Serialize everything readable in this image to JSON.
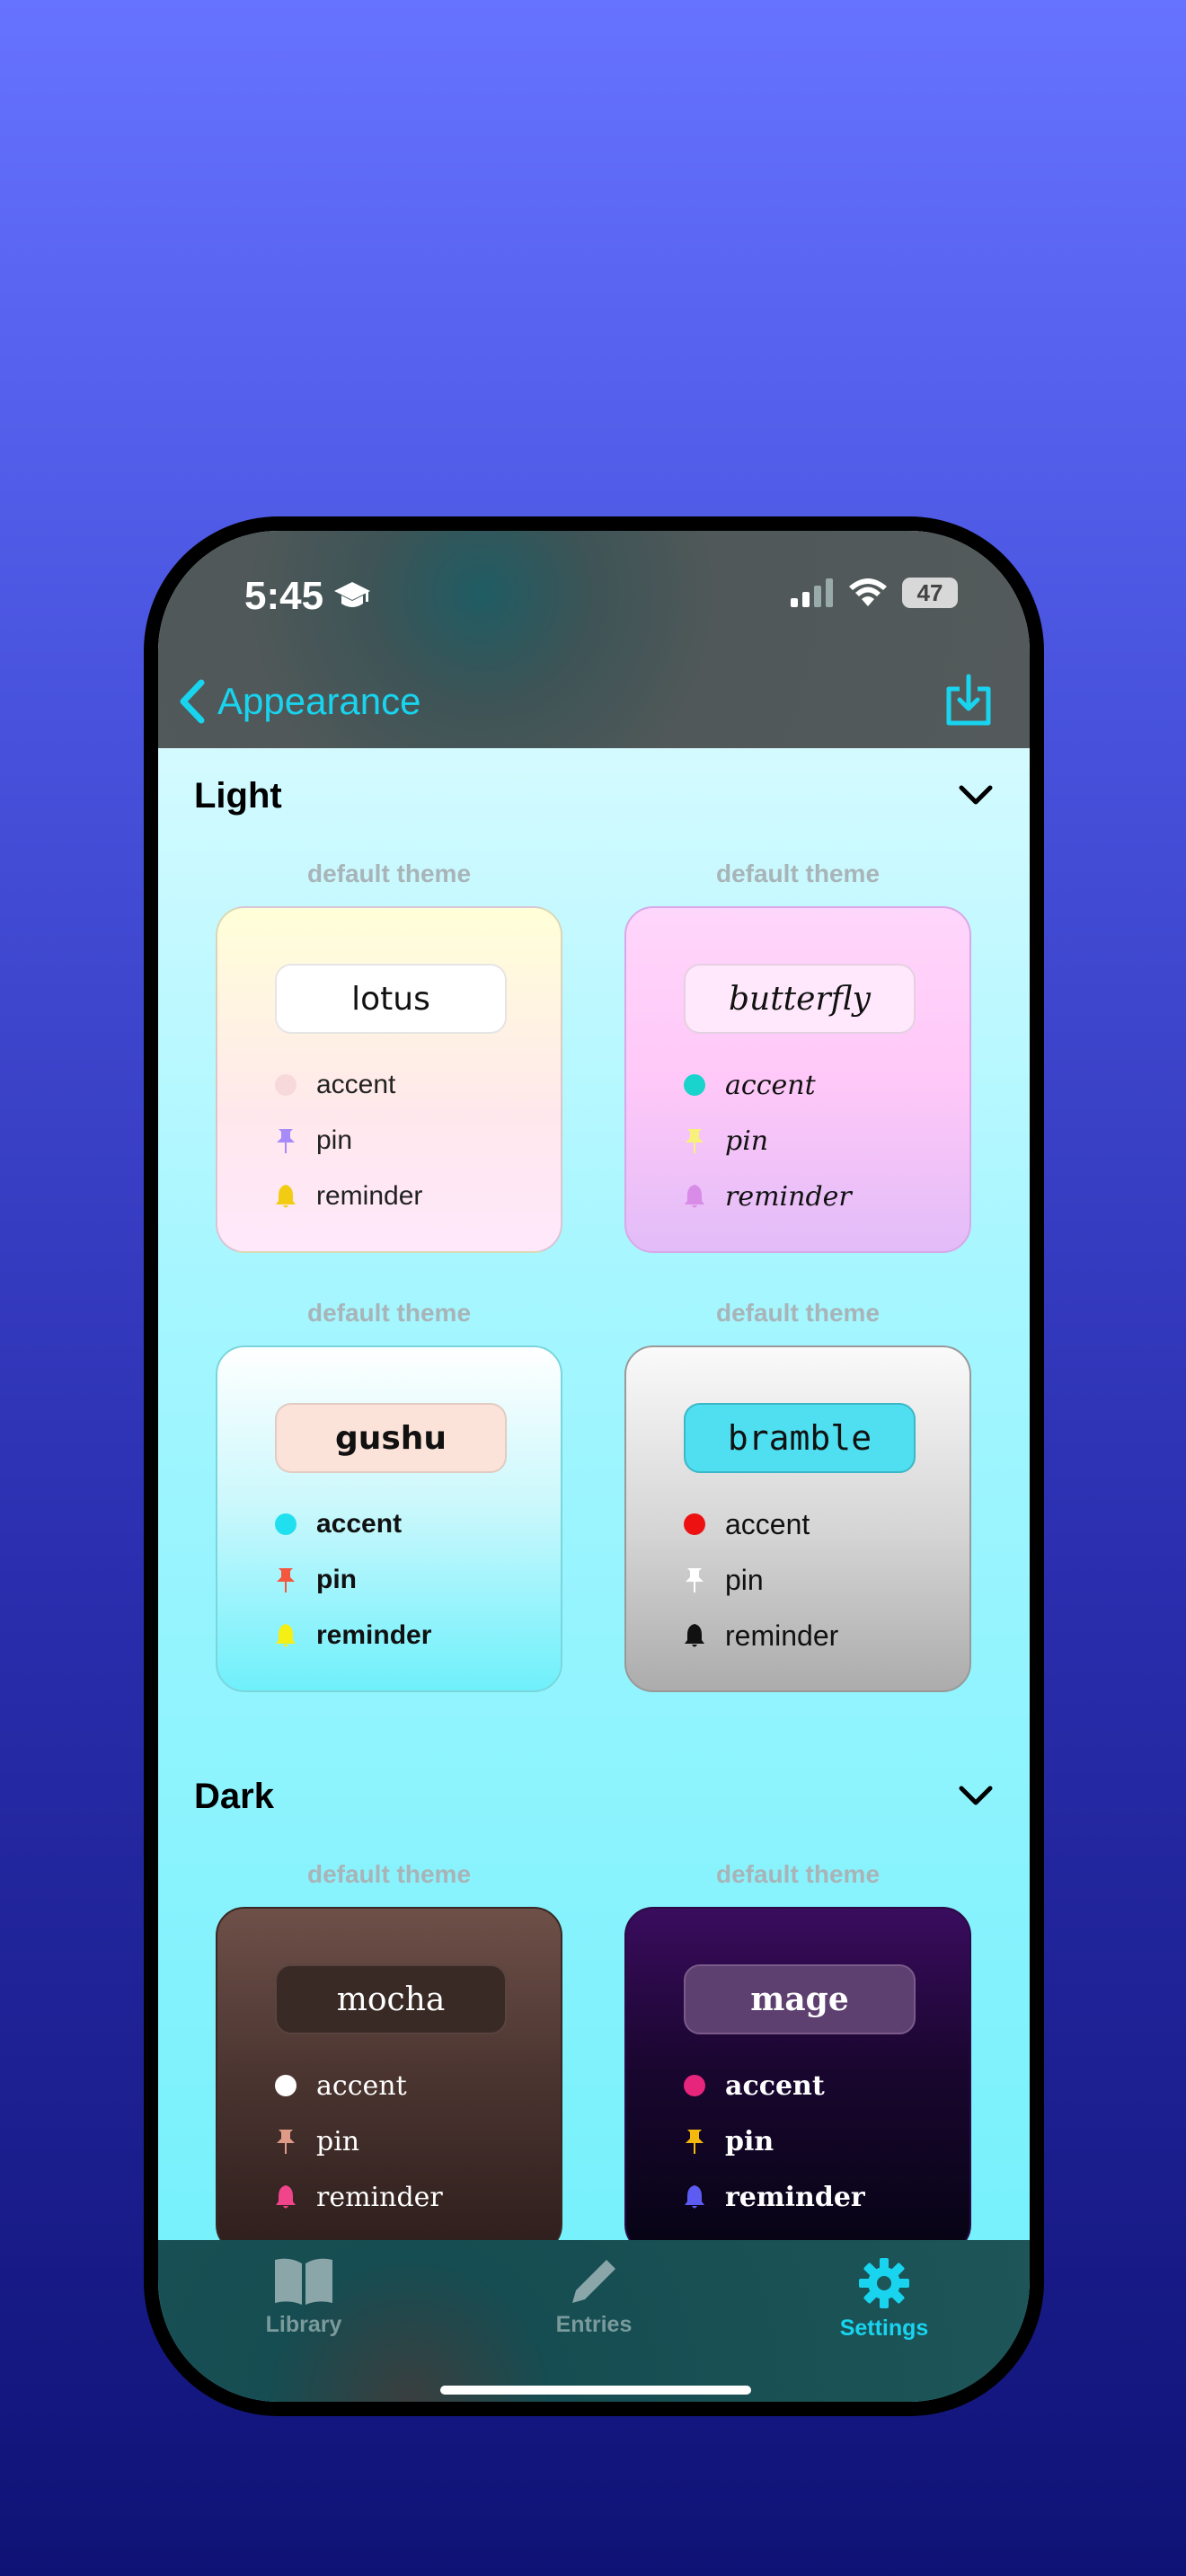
{
  "status": {
    "time": "5:45",
    "battery": "47"
  },
  "nav": {
    "back_label": "Appearance"
  },
  "sections": {
    "light": {
      "title": "Light"
    },
    "dark": {
      "title": "Dark"
    }
  },
  "tile_label": "default theme",
  "themes": [
    {
      "name": "lotus",
      "accent": "accent",
      "pin": "pin",
      "reminder": "reminder",
      "accent_color": "#f7d9d9",
      "pin_color": "#a78bfa",
      "reminder_color": "#f2cc12"
    },
    {
      "name": "butterfly",
      "accent": "accent",
      "pin": "pin",
      "reminder": "reminder",
      "accent_color": "#18d4cc",
      "pin_color": "#f7f07a",
      "reminder_color": "#d98be8"
    },
    {
      "name": "gushu",
      "accent": "accent",
      "pin": "pin",
      "reminder": "reminder",
      "accent_color": "#20e0ef",
      "pin_color": "#f4563e",
      "reminder_color": "#f6ef14"
    },
    {
      "name": "bramble",
      "accent": "accent",
      "pin": "pin",
      "reminder": "reminder",
      "accent_color": "#ee1111",
      "pin_color": "#ffffff",
      "reminder_color": "#111111"
    },
    {
      "name": "mocha",
      "accent": "accent",
      "pin": "pin",
      "reminder": "reminder",
      "accent_color": "#ffffff",
      "pin_color": "#e09a88",
      "reminder_color": "#f0458a"
    },
    {
      "name": "mage",
      "accent": "accent",
      "pin": "pin",
      "reminder": "reminder",
      "accent_color": "#e8257c",
      "pin_color": "#f5b90e",
      "reminder_color": "#5c5cf2"
    }
  ],
  "tabs": {
    "library": "Library",
    "entries": "Entries",
    "settings": "Settings"
  },
  "colors": {
    "accent": "#18d4ef",
    "tab_inactive": "#7a9a9c"
  }
}
